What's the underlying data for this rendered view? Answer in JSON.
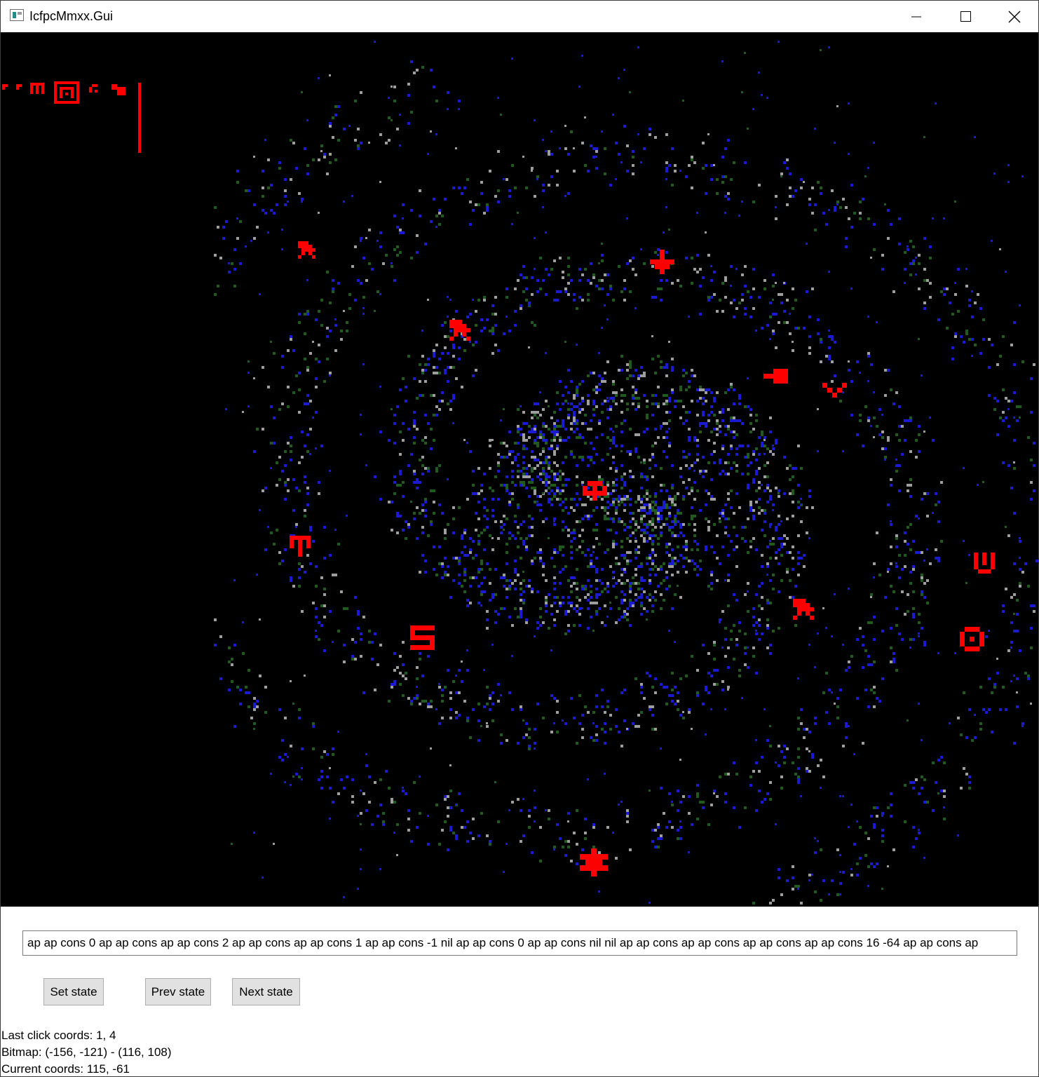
{
  "window": {
    "title": "IcfpcMmxx.Gui",
    "controls": [
      "minimize",
      "maximize",
      "close"
    ]
  },
  "canvas": {
    "background": "#000000",
    "colors": {
      "blue": "#1a1acf",
      "green": "#1f5a1f",
      "gray": "#9e9e9e",
      "red": "#ff0000"
    },
    "icons": [
      "galaxy-dot-spiral",
      "red-glyph-markers"
    ]
  },
  "state_input": {
    "value": "ap ap cons 0 ap ap cons ap ap cons 2 ap ap cons ap ap cons 1 ap ap cons -1 nil ap ap cons 0 ap ap cons nil nil ap ap cons ap ap cons ap ap cons ap ap cons 16 -64 ap ap cons ap"
  },
  "buttons": {
    "set_state": "Set state",
    "prev_state": "Prev state",
    "next_state": "Next state"
  },
  "status": {
    "last_click": "Last click coords: 1, 4",
    "bitmap": "Bitmap: (-156, -121) - (116, 108)",
    "current": "Current coords: 115, -61"
  }
}
